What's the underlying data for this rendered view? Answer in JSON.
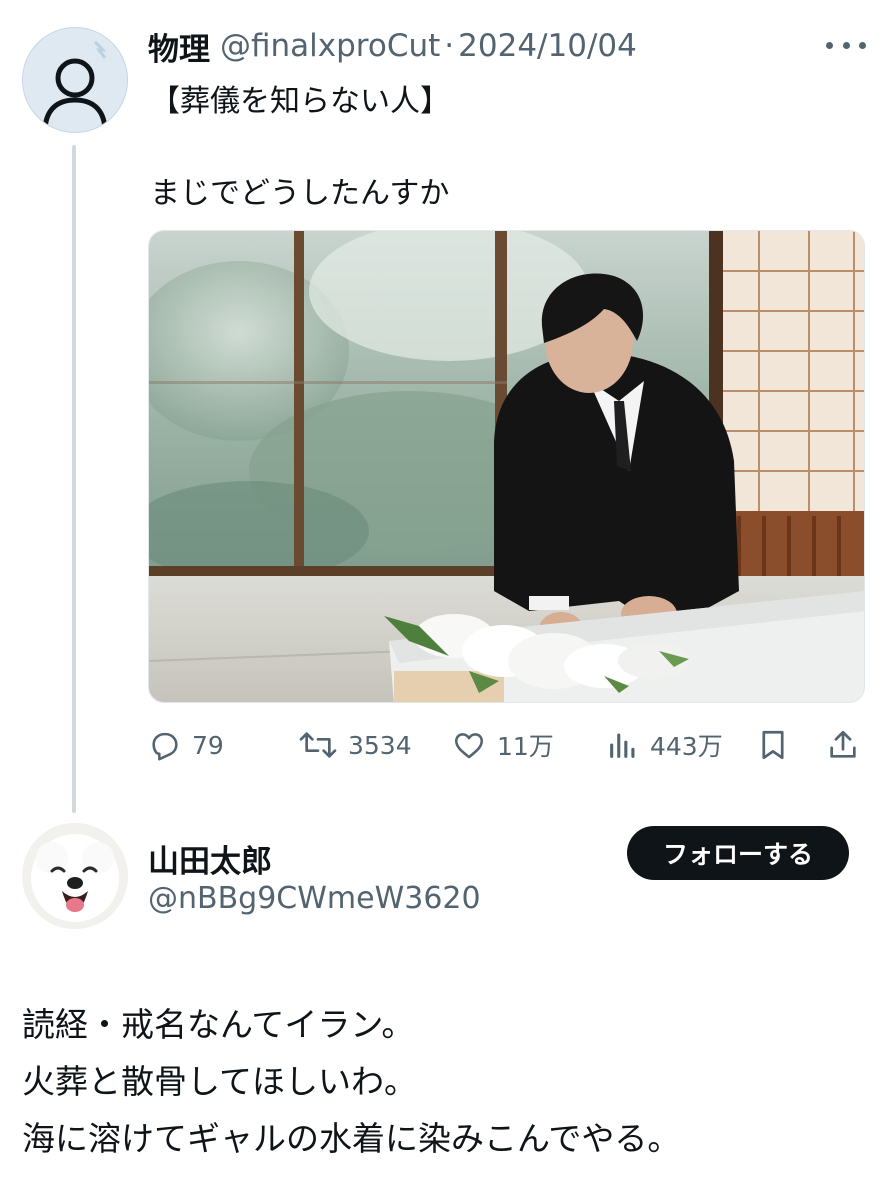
{
  "post": {
    "author_name": "物理",
    "author_handle": "@finalxproCut",
    "separator": "·",
    "date": "2024/10/04",
    "text_line1": "【葬儀を知らない人】",
    "text_line2": "まじでどうしたんすか",
    "stats": {
      "replies": "79",
      "reposts": "3534",
      "likes": "11万",
      "views": "443万"
    }
  },
  "reply_user": {
    "name": "山田太郎",
    "handle": "@nBBg9CWmeW3620",
    "follow_label": "フォローする"
  },
  "reply_text": {
    "line1": "読経・戒名なんてイラン。",
    "line2": "火葬と散骨してほしいわ。",
    "line3": "海に溶けてギャルの水着に染みこんでやる。"
  },
  "colors": {
    "text_primary": "#0f1419",
    "text_secondary": "#536471",
    "thread_line": "#cfd9de",
    "follow_button_bg": "#0f1419"
  },
  "icons": {
    "reply": "reply-icon",
    "repost": "repost-icon",
    "like": "like-icon",
    "views": "views-icon",
    "bookmark": "bookmark-icon",
    "share": "share-icon"
  }
}
